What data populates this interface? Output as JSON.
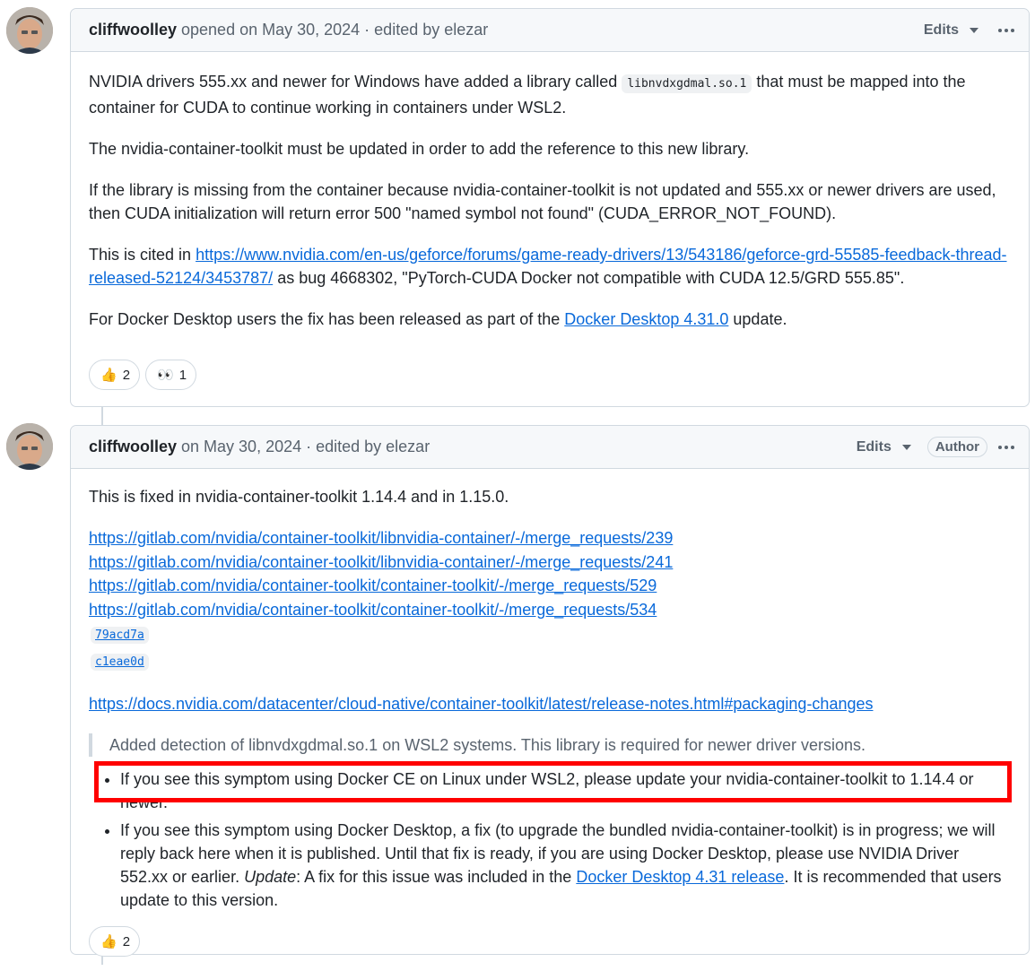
{
  "comments": [
    {
      "author": "cliffwoolley",
      "meta": "opened on May 30, 2024 · edited by elezar",
      "edits_label": "Edits",
      "p1_pre": "NVIDIA drivers 555.xx and newer for Windows have added a library called",
      "p1_code": "libnvdxgdmal.so.1",
      "p1_post": "that must be mapped into the container for CUDA to continue working in containers under WSL2.",
      "p2": "The nvidia-container-toolkit must be updated in order to add the reference to this new library.",
      "p3": "If the library is missing from the container because nvidia-container-toolkit is not updated and 555.xx or newer drivers are used, then CUDA initialization will return error 500 \"named symbol not found\" (CUDA_ERROR_NOT_FOUND).",
      "p4_pre": "This is cited in",
      "p4_link": "https://www.nvidia.com/en-us/geforce/forums/game-ready-drivers/13/543186/geforce-grd-55585-feedback-thread-released-52124/3453787/",
      "p4_post": "as bug 4668302, \"PyTorch-CUDA Docker not compatible with CUDA 12.5/GRD 555.85\".",
      "p5_pre": "For Docker Desktop users the fix has been released as part of the",
      "p5_link": "Docker Desktop 4.31.0",
      "p5_post": "update.",
      "reactions": [
        {
          "emoji": "thumbs-up",
          "glyph": "👍",
          "count": "2"
        },
        {
          "emoji": "eyes",
          "glyph": "👀",
          "count": "1"
        }
      ]
    },
    {
      "author": "cliffwoolley",
      "meta": "on May 30, 2024 · edited by elezar",
      "edits_label": "Edits",
      "badge": "Author",
      "p1": "This is fixed in nvidia-container-toolkit 1.14.4 and in 1.15.0.",
      "links": [
        "https://gitlab.com/nvidia/container-toolkit/libnvidia-container/-/merge_requests/239",
        "https://gitlab.com/nvidia/container-toolkit/libnvidia-container/-/merge_requests/241",
        "https://gitlab.com/nvidia/container-toolkit/container-toolkit/-/merge_requests/529",
        "https://gitlab.com/nvidia/container-toolkit/container-toolkit/-/merge_requests/534"
      ],
      "shas": [
        "79acd7a",
        "c1eae0d"
      ],
      "docs_link": "https://docs.nvidia.com/datacenter/cloud-native/container-toolkit/latest/release-notes.html#packaging-changes",
      "quote": "Added detection of libnvdxgdmal.so.1 on WSL2 systems. This library is required for newer driver versions.",
      "bullet1": "If you see this symptom using Docker CE on Linux under WSL2, please update your nvidia-container-toolkit to 1.14.4 or newer.",
      "bullet2_pre": "If you see this symptom using Docker Desktop, a fix (to upgrade the bundled nvidia-container-toolkit) is in progress; we will reply back here when it is published. Until that fix is ready, if you are using Docker Desktop, please use NVIDIA Driver 552.xx or earlier.",
      "bullet2_update": "Update",
      "bullet2_mid": ": A fix for this issue was included in the",
      "bullet2_link": "Docker Desktop 4.31 release",
      "bullet2_post": ". It is recommended that users update to this version.",
      "reactions": [
        {
          "emoji": "thumbs-up",
          "glyph": "👍",
          "count": "2"
        }
      ]
    }
  ],
  "colors": {
    "link": "#0969da",
    "border": "#d1d9e0",
    "header_bg": "#f6f8fa",
    "highlight": "#ff0000"
  }
}
